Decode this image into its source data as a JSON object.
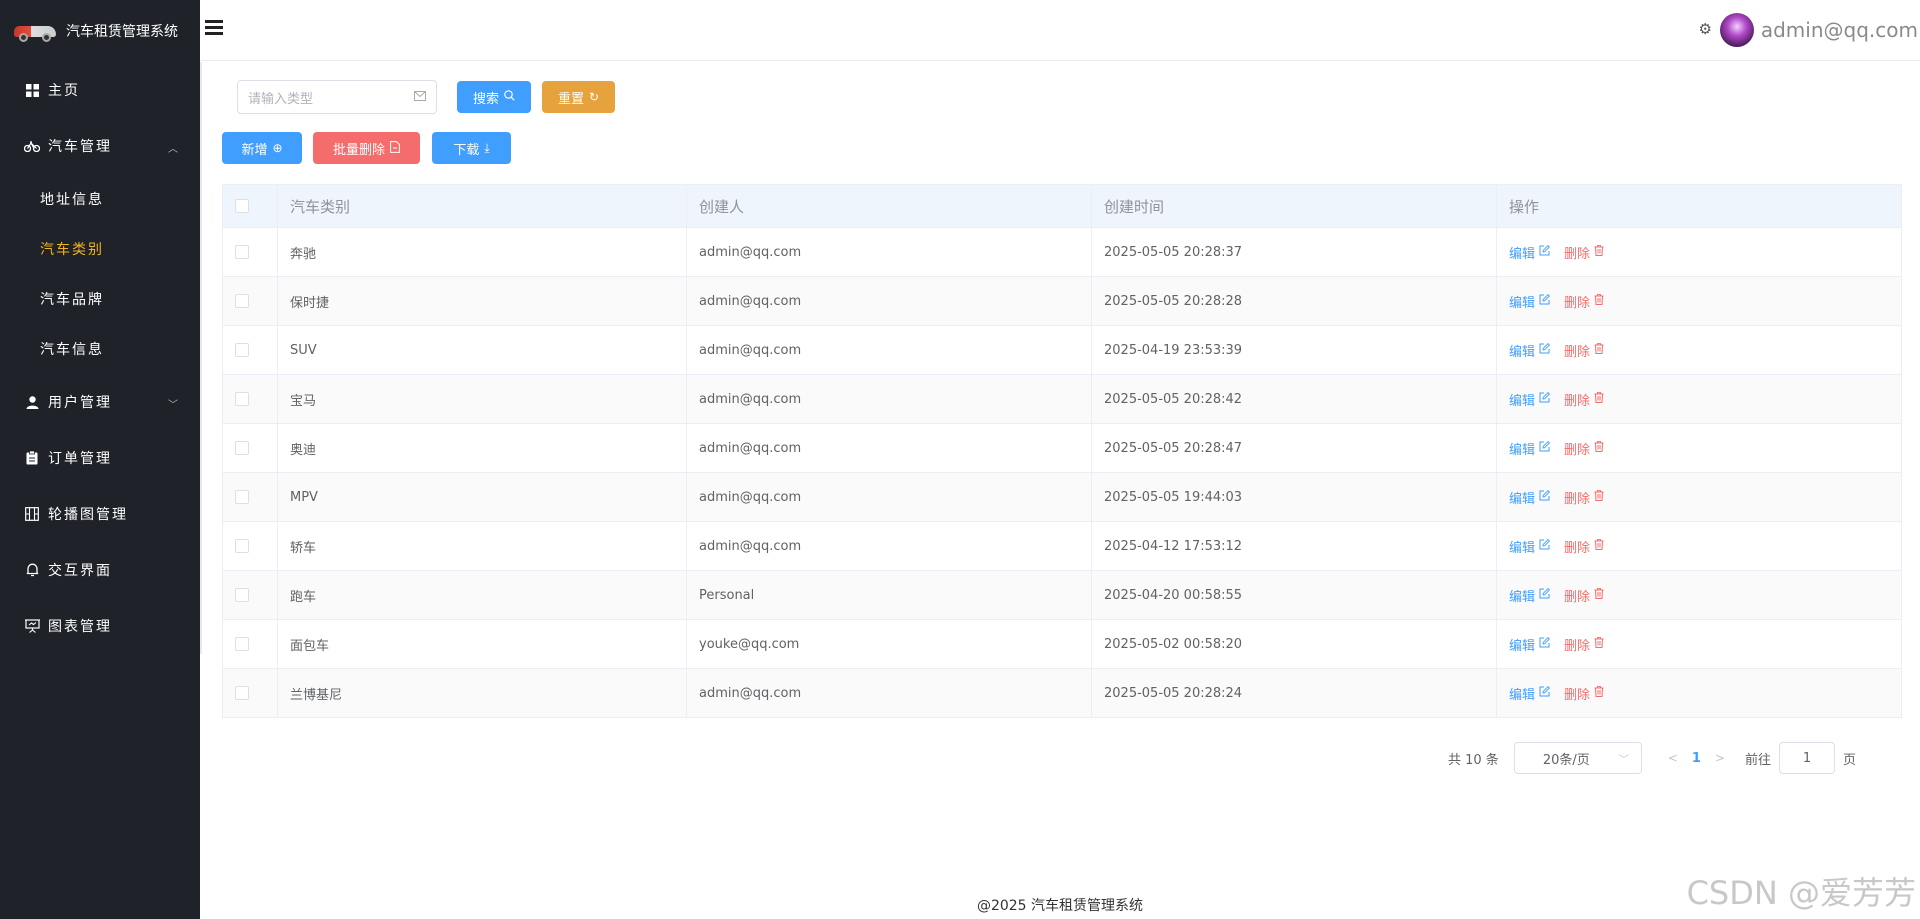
{
  "app": {
    "title": "汽车租赁管理系统"
  },
  "sidebar": {
    "items": [
      {
        "label": "主页",
        "icon": "grid-icon"
      },
      {
        "label": "汽车管理",
        "icon": "bicycle-icon",
        "expanded": true,
        "children": [
          {
            "label": "地址信息",
            "active": false
          },
          {
            "label": "汽车类别",
            "active": true
          },
          {
            "label": "汽车品牌",
            "active": false
          },
          {
            "label": "汽车信息",
            "active": false
          }
        ]
      },
      {
        "label": "用户管理",
        "icon": "user-icon",
        "expanded": false
      },
      {
        "label": "订单管理",
        "icon": "clipboard-icon"
      },
      {
        "label": "轮播图管理",
        "icon": "carousel-icon"
      },
      {
        "label": "交互界面",
        "icon": "bell-icon"
      },
      {
        "label": "图表管理",
        "icon": "presentation-icon"
      }
    ]
  },
  "header": {
    "user": "admin@qq.com"
  },
  "search": {
    "placeholder": "请输入类型",
    "search_label": "搜索",
    "reset_label": "重置"
  },
  "actions": {
    "add_label": "新增",
    "batch_delete_label": "批量删除",
    "download_label": "下载"
  },
  "table": {
    "headers": [
      "汽车类别",
      "创建人",
      "创建时间",
      "操作"
    ],
    "edit_label": "编辑",
    "delete_label": "删除",
    "rows": [
      [
        "奔驰",
        "admin@qq.com",
        "2025-05-05 20:28:37"
      ],
      [
        "保时捷",
        "admin@qq.com",
        "2025-05-05 20:28:28"
      ],
      [
        "SUV",
        "admin@qq.com",
        "2025-04-19 23:53:39"
      ],
      [
        "宝马",
        "admin@qq.com",
        "2025-05-05 20:28:42"
      ],
      [
        "奥迪",
        "admin@qq.com",
        "2025-05-05 20:28:47"
      ],
      [
        "MPV",
        "admin@qq.com",
        "2025-05-05 19:44:03"
      ],
      [
        "轿车",
        "admin@qq.com",
        "2025-04-12 17:53:12"
      ],
      [
        "跑车",
        "Personal",
        "2025-04-20 00:58:55"
      ],
      [
        "面包车",
        "youke@qq.com",
        "2025-05-02 00:58:20"
      ],
      [
        "兰博基尼",
        "admin@qq.com",
        "2025-05-05 20:28:24"
      ]
    ]
  },
  "pagination": {
    "total": "共 10 条",
    "page_size": "20条/页",
    "current": "1",
    "goto_label": "前往",
    "goto_value": "1",
    "page_suffix": "页"
  },
  "footer": "@2025 汽车租赁管理系统",
  "watermark": "CSDN @爱芳芳"
}
